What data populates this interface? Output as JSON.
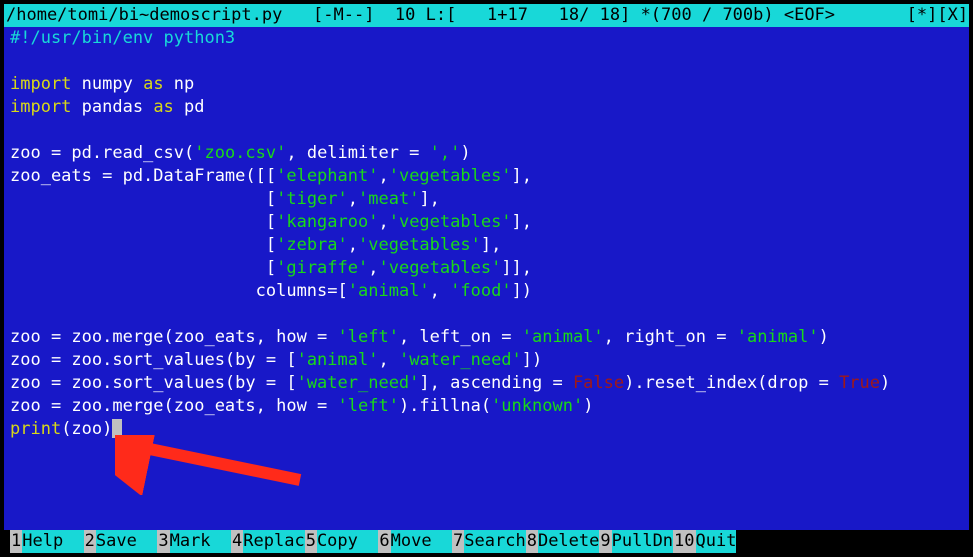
{
  "titlebar": {
    "path": "/home/tomi/bi~demoscript.py",
    "status": "   [-M--]  10 L:[   1+17   18/ 18] *(700 / 700b) <EOF>       [*][X]"
  },
  "code": {
    "l1_a": "#!/usr/bin/env python3",
    "l3_a": "import ",
    "l3_b": "numpy",
    "l3_c": " as ",
    "l3_d": "np",
    "l4_a": "import ",
    "l4_b": "pandas",
    "l4_c": " as ",
    "l4_d": "pd",
    "l6_a": "zoo = pd.read_csv(",
    "l6_b": "'zoo.csv'",
    "l6_c": ", delimiter = ",
    "l6_d": "','",
    "l6_e": ")",
    "l7_a": "zoo_eats = pd.DataFrame([[",
    "l7_b": "'elephant'",
    "l7_c": ",",
    "l7_d": "'vegetables'",
    "l7_e": "],",
    "l8_a": "                         [",
    "l8_b": "'tiger'",
    "l8_c": ",",
    "l8_d": "'meat'",
    "l8_e": "],",
    "l9_a": "                         [",
    "l9_b": "'kangaroo'",
    "l9_c": ",",
    "l9_d": "'vegetables'",
    "l9_e": "],",
    "l10_a": "                         [",
    "l10_b": "'zebra'",
    "l10_c": ",",
    "l10_d": "'vegetables'",
    "l10_e": "],",
    "l11_a": "                         [",
    "l11_b": "'giraffe'",
    "l11_c": ",",
    "l11_d": "'vegetables'",
    "l11_e": "]],",
    "l12_a": "                        columns=[",
    "l12_b": "'animal'",
    "l12_c": ", ",
    "l12_d": "'food'",
    "l12_e": "])",
    "l14_a": "zoo = zoo.merge(zoo_eats, how = ",
    "l14_b": "'left'",
    "l14_c": ", left_on = ",
    "l14_d": "'animal'",
    "l14_e": ", right_on = ",
    "l14_f": "'animal'",
    "l14_g": ")",
    "l15_a": "zoo = zoo.sort_values(by = [",
    "l15_b": "'animal'",
    "l15_c": ", ",
    "l15_d": "'water_need'",
    "l15_e": "])",
    "l16_a": "zoo = zoo.sort_values(by = [",
    "l16_b": "'water_need'",
    "l16_c": "], ascending = ",
    "l16_d": "False",
    "l16_e": ").reset_index(drop = ",
    "l16_f": "True",
    "l16_g": ")",
    "l17_a": "zoo = zoo.merge(zoo_eats, how = ",
    "l17_b": "'left'",
    "l17_c": ").fillna(",
    "l17_d": "'unknown'",
    "l17_e": ")",
    "l18_a": "print",
    "l18_b": "(zoo)"
  },
  "menu": {
    "items": [
      {
        "n": "1",
        "label": "Help  "
      },
      {
        "n": "2",
        "label": "Save  "
      },
      {
        "n": "3",
        "label": "Mark  "
      },
      {
        "n": "4",
        "label": "Replac"
      },
      {
        "n": "5",
        "label": "Copy  "
      },
      {
        "n": "6",
        "label": "Move  "
      },
      {
        "n": "7",
        "label": "Search"
      },
      {
        "n": "8",
        "label": "Delete"
      },
      {
        "n": "9",
        "label": "PullDn"
      },
      {
        "n": "10",
        "label": "Quit"
      }
    ]
  }
}
